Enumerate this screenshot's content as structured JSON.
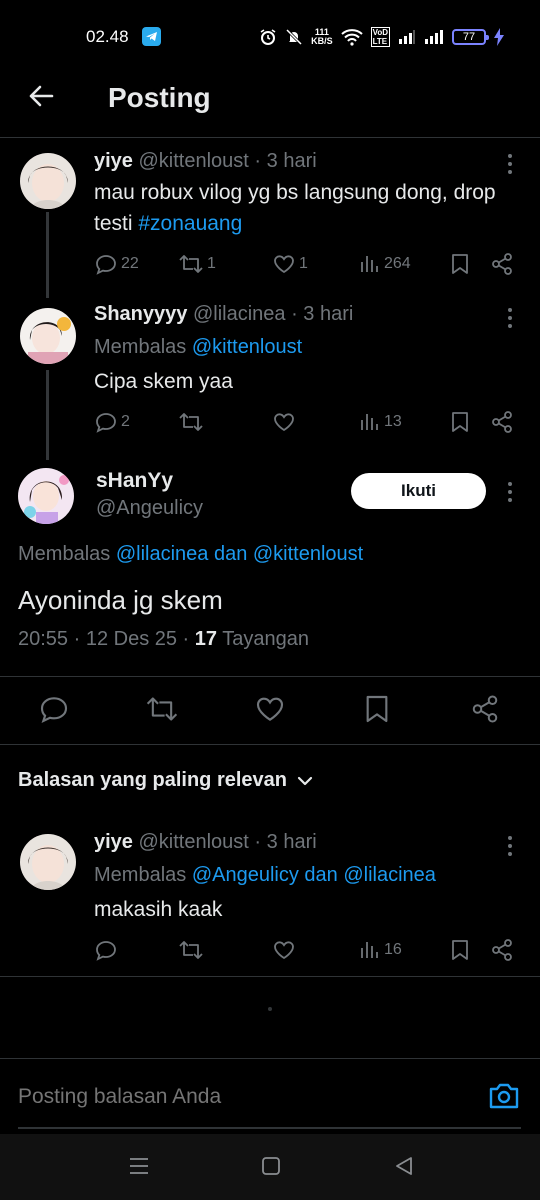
{
  "status_bar": {
    "time": "02.48",
    "speed_value": "111",
    "speed_unit": "KB/S",
    "network_label_1": "VoD",
    "network_label_2": "LTE",
    "battery": "77"
  },
  "header": {
    "title": "Posting"
  },
  "tweet1": {
    "name": "yiye",
    "handle": "@kittenloust",
    "time": "· 3 hari",
    "text_plain": "mau robux vilog yg bs langsung dong, drop testi ",
    "hashtag": "#zonauang",
    "replies": "22",
    "retweets": "1",
    "likes": "1",
    "views": "264"
  },
  "tweet2": {
    "name": "Shanyyyy",
    "handle": "@lilacinea",
    "time": "· 3 hari",
    "replying_prefix": "Membalas",
    "replying_to": "@kittenloust",
    "text": "Cipa skem yaa",
    "replies": "2",
    "views": "13"
  },
  "main_tweet": {
    "name": "sHanYy",
    "handle": "@Angeulicy",
    "follow_label": "Ikuti",
    "replying_prefix": "Membalas",
    "replying_to": "@lilacinea dan @kittenloust",
    "text": "Ayoninda jg skem",
    "timestamp": "20:55 · 12 Des 25 ·",
    "views_count": "17",
    "views_label": "Tayangan"
  },
  "sort": {
    "label": "Balasan yang paling relevan"
  },
  "reply1": {
    "name": "yiye",
    "handle": "@kittenloust",
    "time": "· 3 hari",
    "replying_prefix": "Membalas",
    "replying_to": "@Angeulicy dan @lilacinea",
    "text": "makasih kaak",
    "views": "16"
  },
  "reply_bar": {
    "placeholder": "Posting balasan Anda"
  },
  "colors": {
    "accent": "#1d9bf0",
    "background": "#000000",
    "muted": "#71767b"
  },
  "icons": [
    "back-arrow-icon",
    "more-icon",
    "reply-icon",
    "retweet-icon",
    "like-icon",
    "views-icon",
    "bookmark-icon",
    "share-icon",
    "camera-icon",
    "chevron-down-icon"
  ]
}
